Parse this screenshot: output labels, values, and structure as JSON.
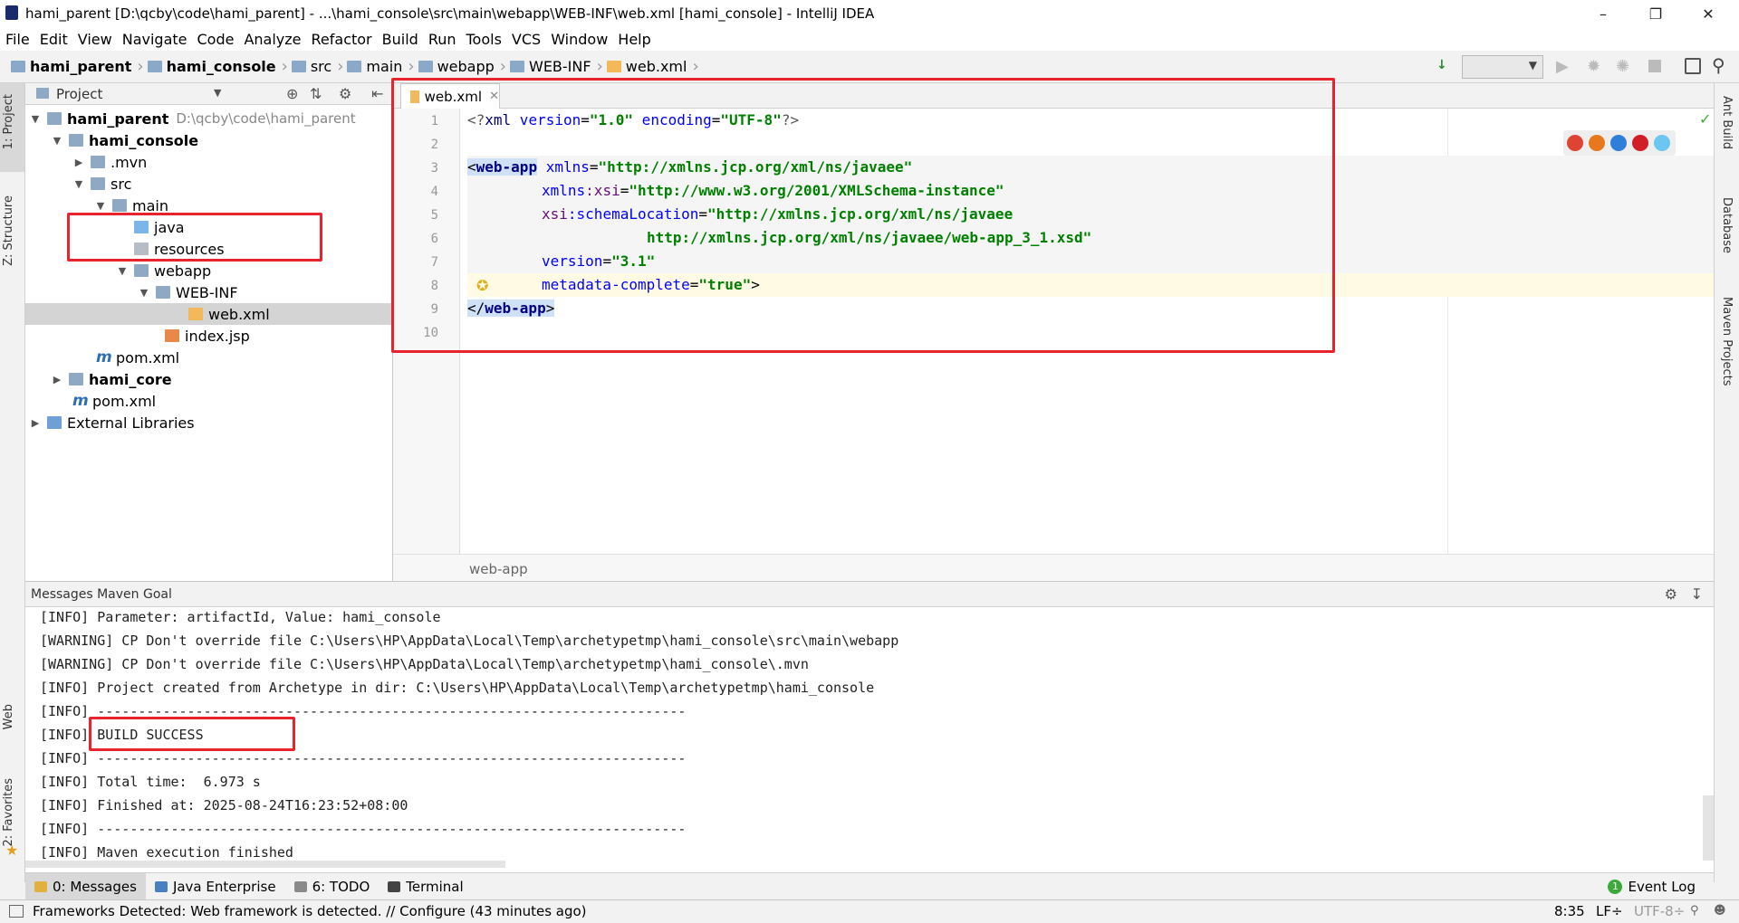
{
  "window": {
    "title": "hami_parent [D:\\qcby\\code\\hami_parent] - ...\\hami_console\\src\\main\\webapp\\WEB-INF\\web.xml [hami_console] - IntelliJ IDEA"
  },
  "menu": [
    "File",
    "Edit",
    "View",
    "Navigate",
    "Code",
    "Analyze",
    "Refactor",
    "Build",
    "Run",
    "Tools",
    "VCS",
    "Window",
    "Help"
  ],
  "breadcrumb": [
    "hami_parent",
    "hami_console",
    "src",
    "main",
    "webapp",
    "WEB-INF",
    "web.xml"
  ],
  "left_tool_tabs": {
    "project": "1: Project",
    "structure": "Z: Structure",
    "web": "Web",
    "favorites": "2: Favorites"
  },
  "right_tool_tabs": {
    "ant": "Ant Build",
    "database": "Database",
    "maven": "Maven Projects"
  },
  "project_panel": {
    "header": "Project",
    "tree": [
      {
        "label": "hami_parent",
        "path": "D:\\qcby\\code\\hami_parent",
        "depth": 0,
        "expanded": true,
        "bold": true,
        "icon": "module-folder-icon"
      },
      {
        "label": "hami_console",
        "depth": 1,
        "expanded": true,
        "bold": true,
        "icon": "module-folder-icon"
      },
      {
        "label": ".mvn",
        "depth": 2,
        "expanded": false,
        "icon": "folder-icon"
      },
      {
        "label": "src",
        "depth": 2,
        "expanded": true,
        "icon": "folder-icon"
      },
      {
        "label": "main",
        "depth": 3,
        "expanded": true,
        "icon": "folder-icon"
      },
      {
        "label": "java",
        "depth": 4,
        "icon": "source-folder-icon"
      },
      {
        "label": "resources",
        "depth": 4,
        "icon": "resources-folder-icon"
      },
      {
        "label": "webapp",
        "depth": 4,
        "expanded": true,
        "icon": "web-folder-icon"
      },
      {
        "label": "WEB-INF",
        "depth": 5,
        "expanded": true,
        "icon": "folder-icon"
      },
      {
        "label": "web.xml",
        "depth": 6,
        "selected": true,
        "icon": "xml-file-icon"
      },
      {
        "label": "index.jsp",
        "depth": 5,
        "icon": "jsp-file-icon"
      },
      {
        "label": "pom.xml",
        "depth": 2,
        "icon": "maven-icon"
      },
      {
        "label": "hami_core",
        "depth": 1,
        "expanded": false,
        "bold": true,
        "icon": "module-folder-icon"
      },
      {
        "label": "pom.xml",
        "depth": 1,
        "icon": "maven-icon"
      },
      {
        "label": "External Libraries",
        "depth": 0,
        "expanded": false,
        "icon": "library-icon"
      }
    ]
  },
  "editor": {
    "tab": "web.xml",
    "lines": [
      "1",
      "2",
      "3",
      "4",
      "5",
      "6",
      "7",
      "8",
      "9",
      "10"
    ],
    "code": {
      "l1_a": "<?",
      "l1_b": "xml",
      "l1_c": " version",
      "l1_d": "=",
      "l1_e": "\"1.0\"",
      "l1_f": " encoding",
      "l1_g": "=",
      "l1_h": "\"UTF-8\"",
      "l1_i": "?>",
      "l3_a": "<",
      "l3_b": "web-app",
      "l3_c": " xmlns",
      "l3_d": "=",
      "l3_e": "\"http://xmlns.jcp.org/xml/ns/javaee\"",
      "l4_a": "xmlns",
      "l4_b": ":xsi",
      "l4_c": "=",
      "l4_d": "\"http://www.w3.org/2001/XMLSchema-instance\"",
      "l5_a": "xsi",
      "l5_b": ":schemaLocation",
      "l5_c": "=",
      "l5_d": "\"http://xmlns.jcp.org/xml/ns/javaee",
      "l6_a": "http://xmlns.jcp.org/xml/ns/javaee/web-app_3_1.xsd\"",
      "l7_a": "version",
      "l7_b": "=",
      "l7_c": "\"3.1\"",
      "l8_a": "metadata-complete",
      "l8_b": "=",
      "l8_c": "\"true\"",
      "l8_d": ">",
      "l9_a": "</",
      "l9_b": "web-app",
      "l9_c": ">"
    },
    "breadcrumb": "web-app"
  },
  "messages": {
    "header": "Messages Maven Goal",
    "lines": [
      "[INFO] Parameter: artifactId, Value: hami_console",
      "[WARNING] CP Don't override file C:\\Users\\HP\\AppData\\Local\\Temp\\archetypetmp\\hami_console\\src\\main\\webapp",
      "[WARNING] CP Don't override file C:\\Users\\HP\\AppData\\Local\\Temp\\archetypetmp\\hami_console\\.mvn",
      "[INFO] Project created from Archetype in dir: C:\\Users\\HP\\AppData\\Local\\Temp\\archetypetmp\\hami_console",
      "[INFO] ------------------------------------------------------------------------",
      "[INFO] BUILD SUCCESS",
      "[INFO] ------------------------------------------------------------------------",
      "[INFO] Total time:  6.973 s",
      "[INFO] Finished at: 2025-08-24T16:23:52+08:00",
      "[INFO] ------------------------------------------------------------------------",
      "[INFO] Maven execution finished"
    ]
  },
  "bottom_tabs": {
    "messages": "0: Messages",
    "java_enterprise": "Java Enterprise",
    "todo": "6: TODO",
    "terminal": "Terminal",
    "event_log": "Event Log",
    "event_count": "1"
  },
  "status": {
    "message": "Frameworks Detected: Web framework is detected. // Configure (43 minutes ago)",
    "position": "8:35",
    "line_sep": "LF÷",
    "encoding": "UTF-8÷"
  },
  "colors": {
    "highlight": "#e8232d",
    "accent": "#2e6eb5"
  }
}
